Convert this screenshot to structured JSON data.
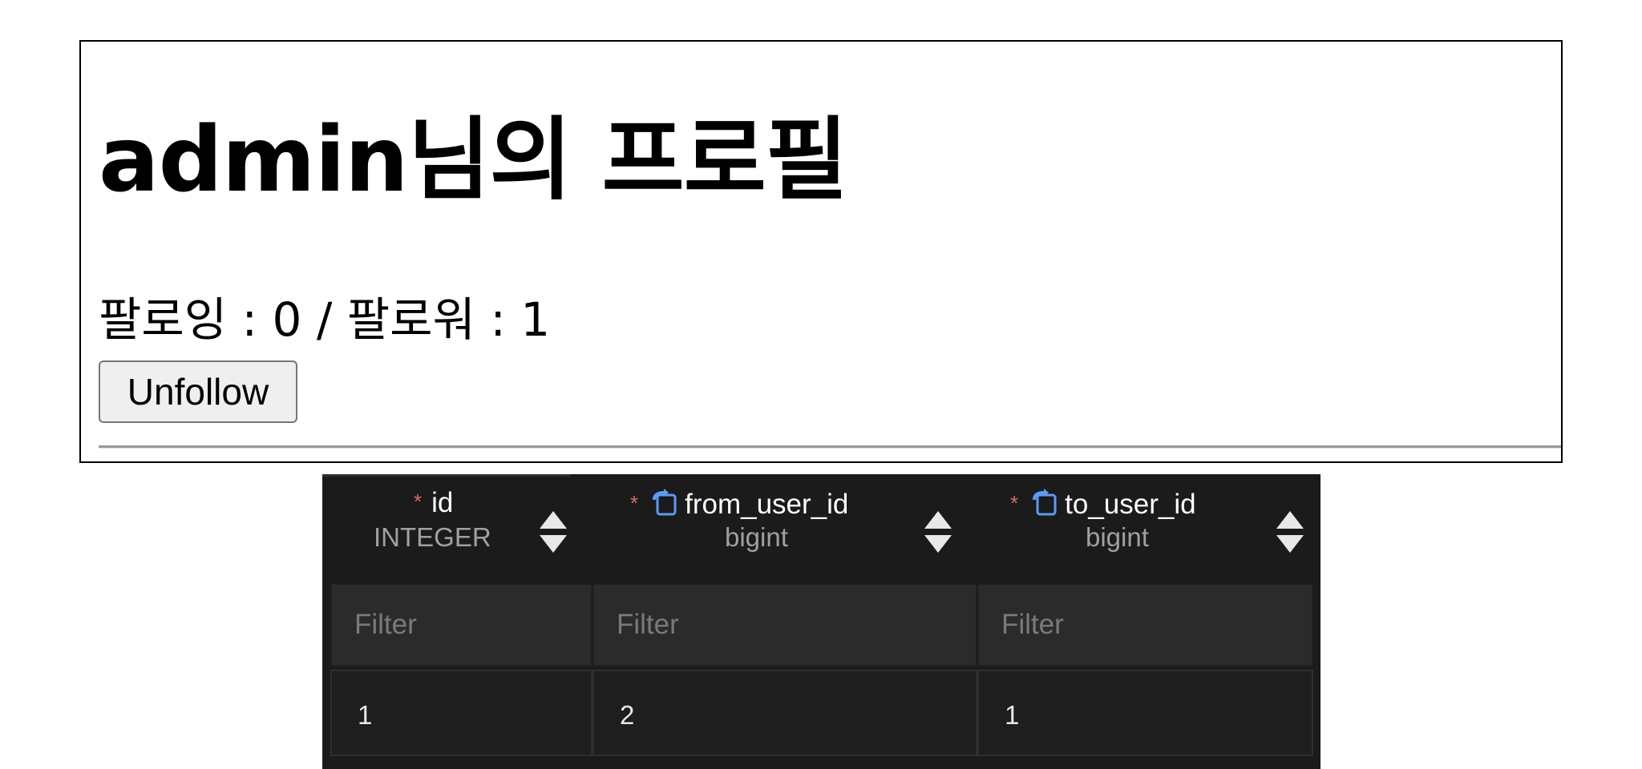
{
  "profile": {
    "title": "admin님의 프로필",
    "follow_stats": "팔로잉 : 0 / 팔로워 : 1",
    "unfollow_label": "Unfollow"
  },
  "db_table": {
    "columns": [
      {
        "name": "id",
        "type": "INTEGER",
        "required": true,
        "foreign_key": false
      },
      {
        "name": "from_user_id",
        "type": "bigint",
        "required": true,
        "foreign_key": true
      },
      {
        "name": "to_user_id",
        "type": "bigint",
        "required": true,
        "foreign_key": true
      }
    ],
    "required_marker": "*",
    "filter_placeholder": "Filter",
    "rows": [
      [
        "1",
        "2",
        "1"
      ]
    ],
    "icons": {
      "required": "asterisk-icon",
      "foreign_key": "foreign-key-icon",
      "sort": "sort-icon"
    },
    "colors": {
      "background": "#1b1b1b",
      "required_star": "#e06666",
      "fk_icon": "#5b9bf8",
      "type_text": "#a0a0a0"
    }
  }
}
